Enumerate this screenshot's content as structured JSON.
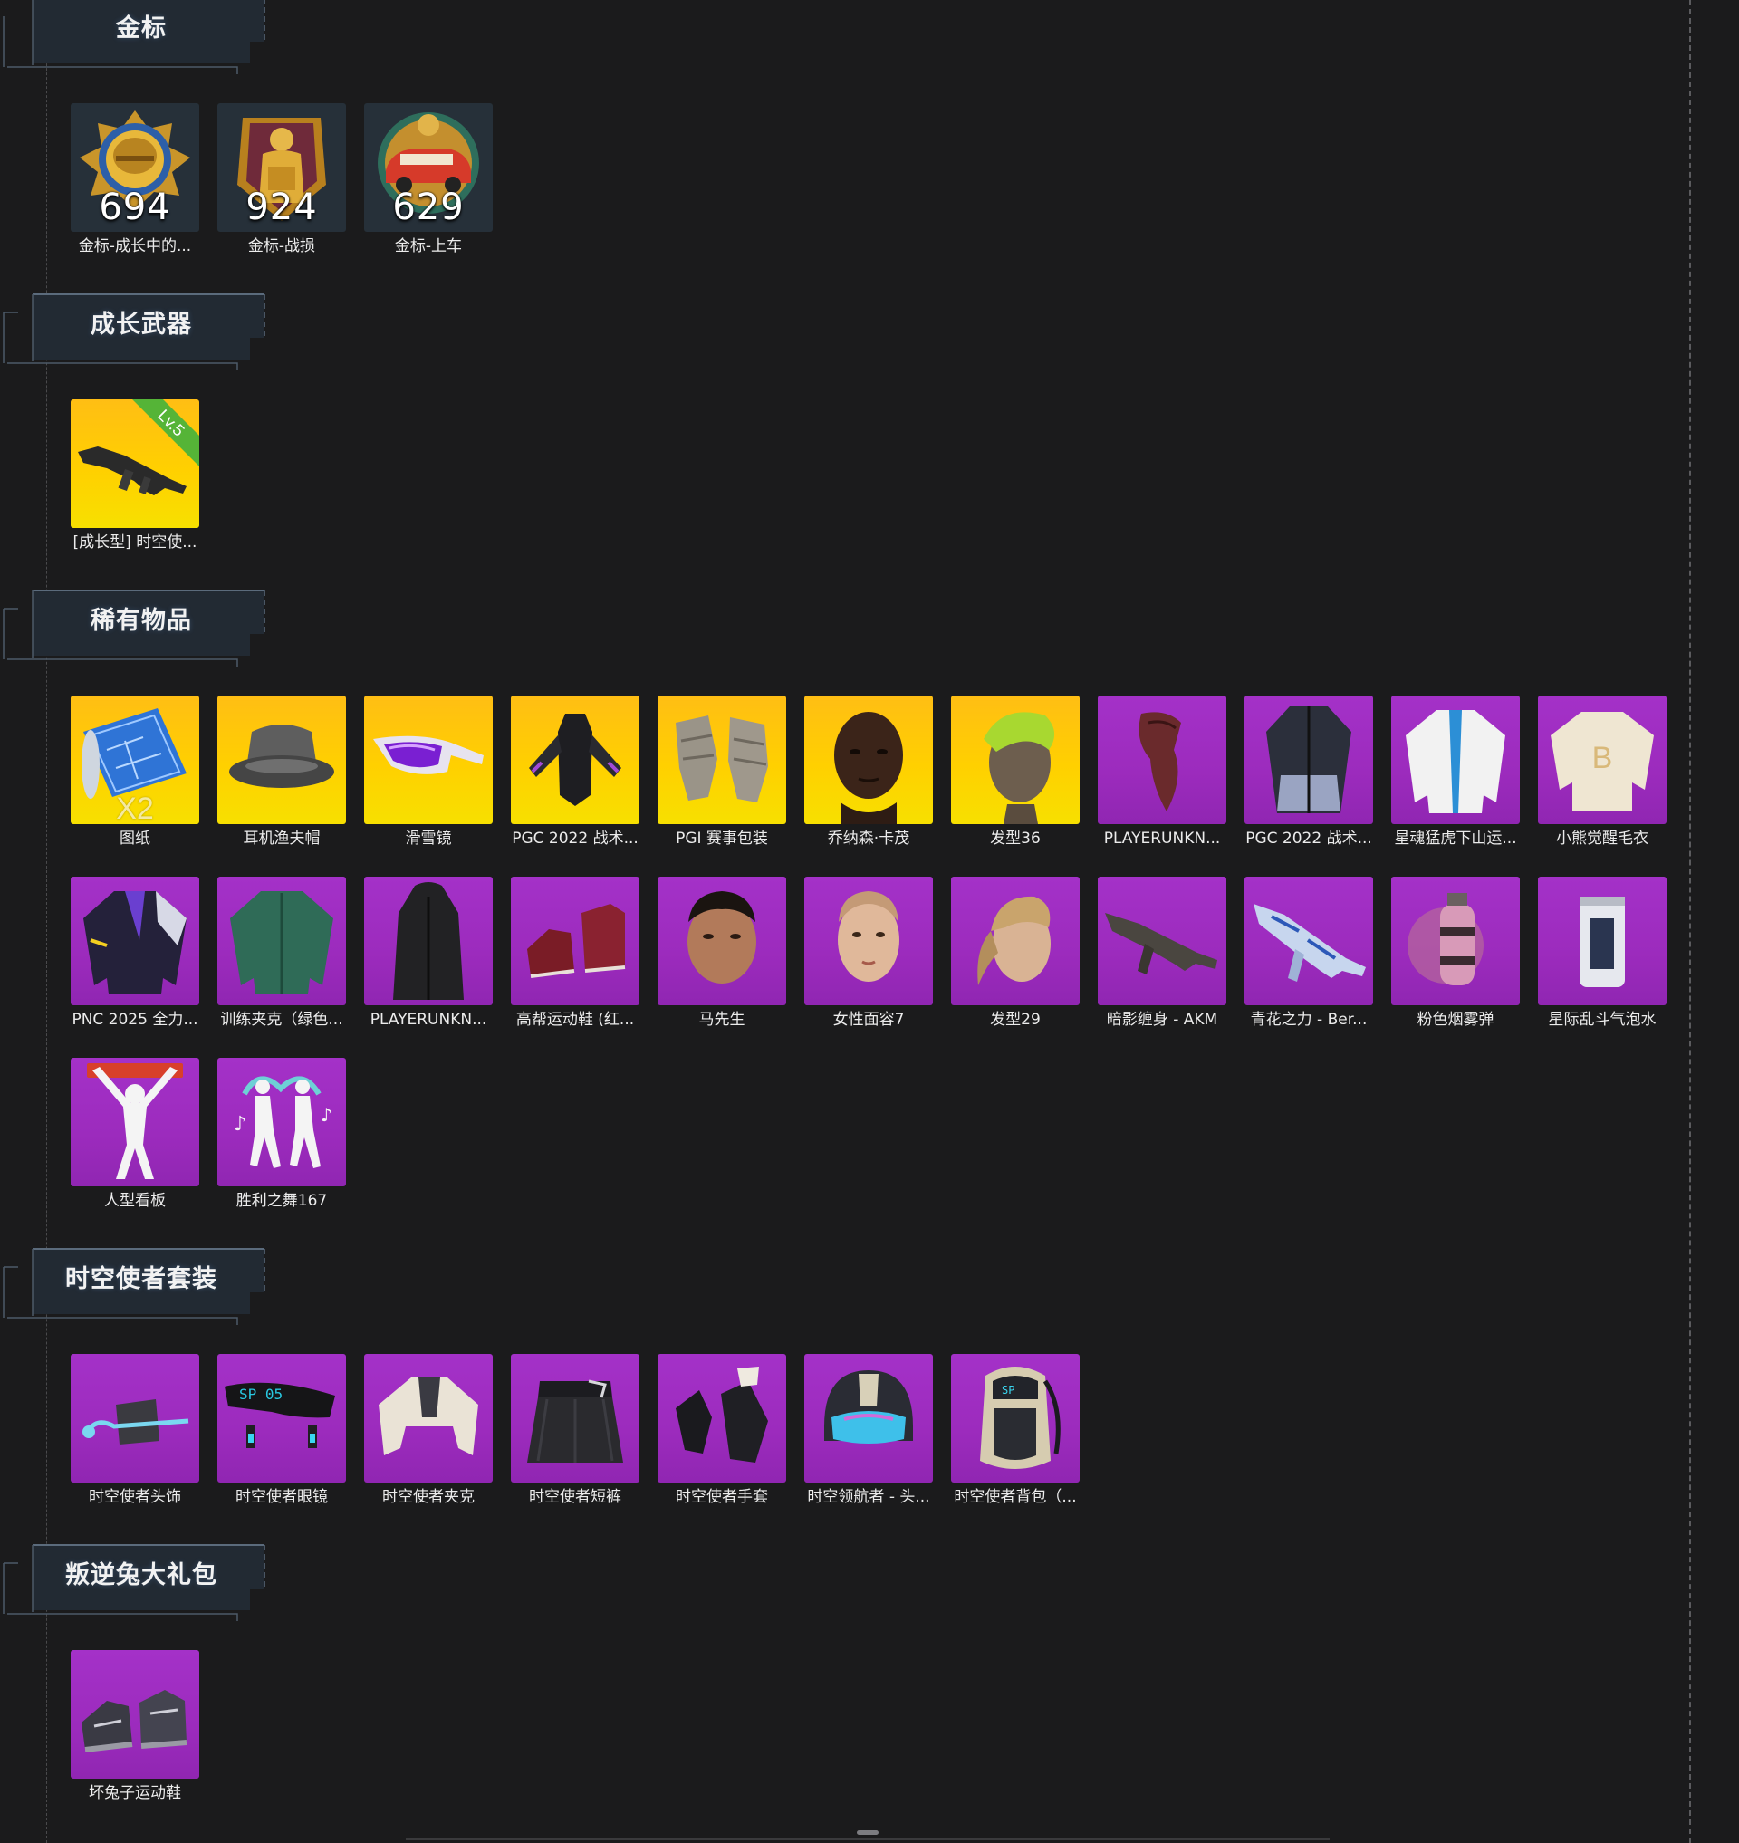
{
  "sections": [
    {
      "id": "gold-badges",
      "title": "金标",
      "items": [
        {
          "label": "金标-成长中的...",
          "value": "694",
          "icon": "gold-medal-helmet-icon"
        },
        {
          "label": "金标-战损",
          "value": "924",
          "icon": "gold-medal-soldier-icon"
        },
        {
          "label": "金标-上车",
          "value": "629",
          "icon": "gold-medal-car-icon"
        }
      ]
    },
    {
      "id": "growth-weapons",
      "title": "成长武器",
      "items": [
        {
          "label": "[成长型] 时空使...",
          "badge": "Lv.5",
          "icon": "rifle-icon"
        }
      ]
    },
    {
      "id": "rare-items",
      "title": "稀有物品",
      "items": [
        {
          "label": "图纸",
          "overlay": "X2",
          "icon": "blueprint-icon",
          "rarity": "gold"
        },
        {
          "label": "耳机渔夫帽",
          "icon": "bucket-hat-icon",
          "rarity": "gold"
        },
        {
          "label": "滑雪镜",
          "icon": "goggles-icon",
          "rarity": "gold"
        },
        {
          "label": "PGC 2022 战术...",
          "icon": "tactical-vest-icon",
          "rarity": "gold"
        },
        {
          "label": "PGI 赛事包装",
          "icon": "hand-wrap-icon",
          "rarity": "gold"
        },
        {
          "label": "乔纳森·卡茂",
          "icon": "male-face-icon",
          "rarity": "gold"
        },
        {
          "label": "发型36",
          "icon": "hairstyle-icon",
          "rarity": "gold"
        },
        {
          "label": "PLAYERUNKN...",
          "icon": "mask-icon",
          "rarity": "purple"
        },
        {
          "label": "PGC 2022 战术...",
          "icon": "tactical-coat-icon",
          "rarity": "purple"
        },
        {
          "label": "星魂猛虎下山运...",
          "icon": "jacket-icon",
          "rarity": "purple"
        },
        {
          "label": "小熊觉醒毛衣",
          "icon": "sweater-icon",
          "rarity": "purple"
        },
        {
          "label": "PNC 2025 全力...",
          "icon": "jacket-icon",
          "rarity": "purple"
        },
        {
          "label": "训练夹克（绿色...",
          "icon": "green-jacket-icon",
          "rarity": "purple"
        },
        {
          "label": "PLAYERUNKN...",
          "icon": "long-coat-icon",
          "rarity": "purple"
        },
        {
          "label": "高帮运动鞋 (红...",
          "icon": "sneakers-icon",
          "rarity": "purple"
        },
        {
          "label": "马先生",
          "icon": "male-face-icon",
          "rarity": "purple"
        },
        {
          "label": "女性面容7",
          "icon": "female-face-icon",
          "rarity": "purple"
        },
        {
          "label": "发型29",
          "icon": "ponytail-icon",
          "rarity": "purple"
        },
        {
          "label": "暗影缠身 - AKM",
          "icon": "rifle-icon",
          "rarity": "purple"
        },
        {
          "label": "青花之力 - Ber...",
          "icon": "rifle-icon",
          "rarity": "purple"
        },
        {
          "label": "粉色烟雾弹",
          "icon": "smoke-grenade-icon",
          "rarity": "purple"
        },
        {
          "label": "星际乱斗气泡水",
          "icon": "soda-can-icon",
          "rarity": "purple"
        },
        {
          "label": "人型看板",
          "icon": "cheering-figure-icon",
          "rarity": "purple"
        },
        {
          "label": "胜利之舞167",
          "icon": "dancing-figures-icon",
          "rarity": "purple"
        }
      ]
    },
    {
      "id": "time-envoy-set",
      "title": "时空使者套装",
      "items": [
        {
          "label": "时空使者头饰",
          "icon": "headpiece-icon",
          "rarity": "purple"
        },
        {
          "label": "时空使者眼镜",
          "icon": "glasses-icon",
          "rarity": "purple"
        },
        {
          "label": "时空使者夹克",
          "icon": "crop-jacket-icon",
          "rarity": "purple"
        },
        {
          "label": "时空使者短裤",
          "icon": "skirt-icon",
          "rarity": "purple"
        },
        {
          "label": "时空使者手套",
          "icon": "gloves-icon",
          "rarity": "purple"
        },
        {
          "label": "时空领航者 - 头...",
          "icon": "helmet-icon",
          "rarity": "purple"
        },
        {
          "label": "时空使者背包（...",
          "icon": "backpack-icon",
          "rarity": "purple"
        }
      ]
    },
    {
      "id": "rebel-rabbit-pack",
      "title": "叛逆兔大礼包",
      "items": [
        {
          "label": "坏兔子运动鞋",
          "icon": "sneakers-icon",
          "rarity": "purple"
        }
      ]
    }
  ],
  "colors": {
    "background": "#1b1b1c",
    "gold_tile": "#ffd000",
    "purple_tile": "#a02fc2",
    "medal_tile": "#263039",
    "level_badge": "#55b437"
  }
}
